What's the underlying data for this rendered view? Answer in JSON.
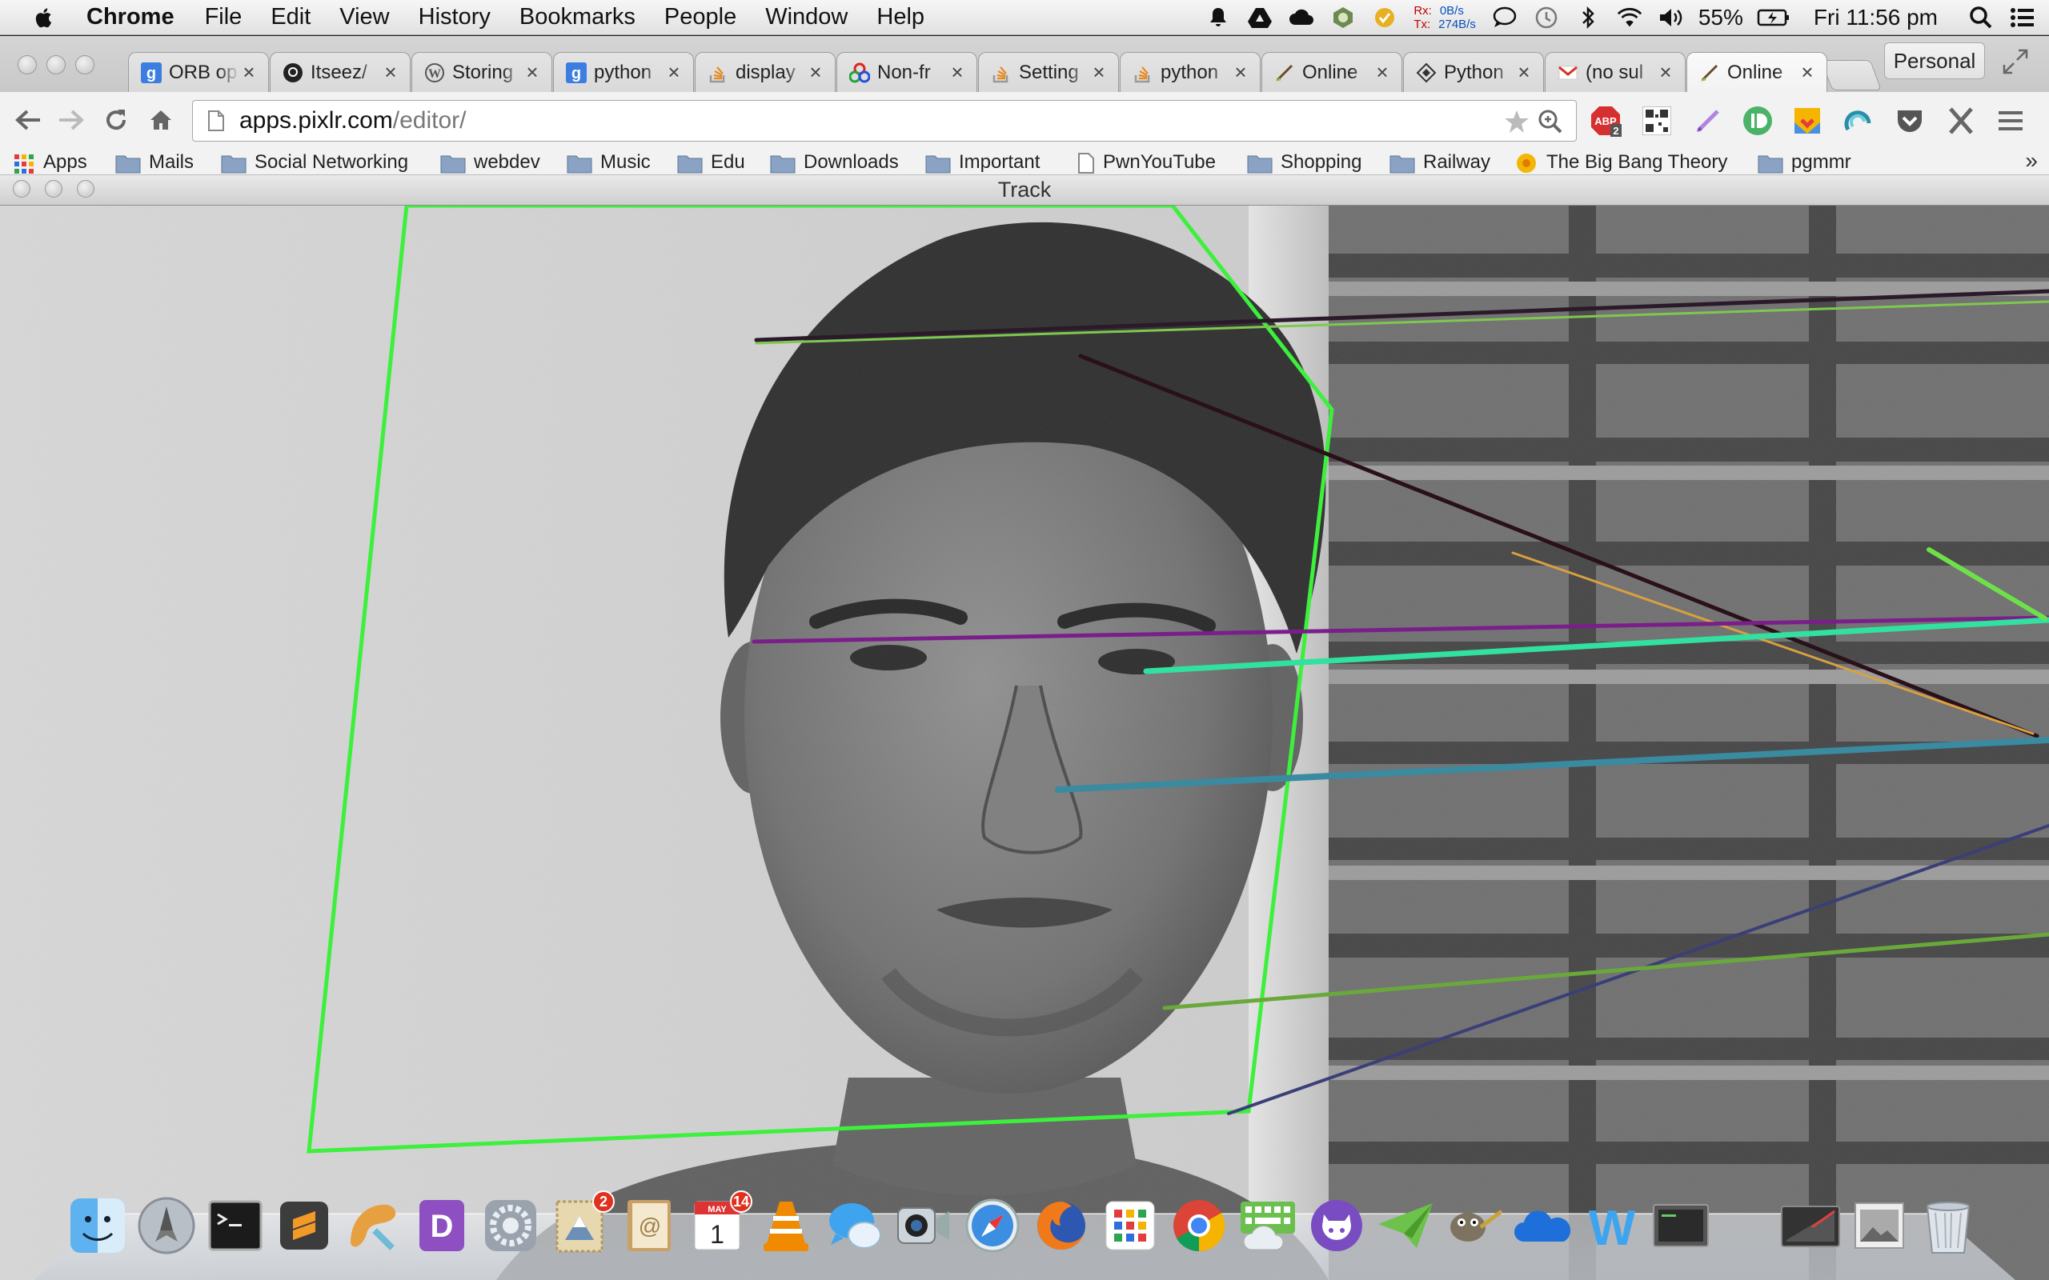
{
  "menubar": {
    "app_name": "Chrome",
    "items": [
      "File",
      "Edit",
      "View",
      "History",
      "Bookmarks",
      "People",
      "Window",
      "Help"
    ],
    "status": {
      "net_rx_label": "Rx:",
      "net_rx_value": "0B/s",
      "net_tx_label": "Tx:",
      "net_tx_value": "274B/s",
      "battery": "55%",
      "clock": "Fri 11:56 pm"
    }
  },
  "tabs": [
    {
      "title": "ORB op",
      "icon": "google-icon"
    },
    {
      "title": "Itseez/",
      "icon": "github-icon"
    },
    {
      "title": "Storing",
      "icon": "wordpress-icon"
    },
    {
      "title": "python",
      "icon": "google-icon"
    },
    {
      "title": "display",
      "icon": "stackoverflow-icon"
    },
    {
      "title": "Non-fr",
      "icon": "colorful-logo-icon"
    },
    {
      "title": "Setting",
      "icon": "stackoverflow-icon"
    },
    {
      "title": "python",
      "icon": "stackoverflow-icon"
    },
    {
      "title": "Online",
      "icon": "pixlr-brush-icon"
    },
    {
      "title": "Python",
      "icon": "python-diamond-icon"
    },
    {
      "title": "(no sul",
      "icon": "gmail-icon"
    },
    {
      "title": "Online",
      "icon": "pixlr-brush-icon",
      "active": true
    }
  ],
  "profile_label": "Personal",
  "omnibox": {
    "host": "apps.pixlr.com",
    "path": "/editor/"
  },
  "extensions": {
    "abp_label": "ABP",
    "abp_badge": "2"
  },
  "bookmarks": [
    {
      "label": "Apps",
      "icon": "apps-grid-icon"
    },
    {
      "label": "Mails",
      "icon": "folder-icon"
    },
    {
      "label": "Social Networking",
      "icon": "folder-icon"
    },
    {
      "label": "webdev",
      "icon": "folder-icon"
    },
    {
      "label": "Music",
      "icon": "folder-icon"
    },
    {
      "label": "Edu",
      "icon": "folder-icon"
    },
    {
      "label": "Downloads",
      "icon": "folder-icon"
    },
    {
      "label": "Important",
      "icon": "folder-icon"
    },
    {
      "label": "PwnYouTube",
      "icon": "page-icon"
    },
    {
      "label": "Shopping",
      "icon": "folder-icon"
    },
    {
      "label": "Railway",
      "icon": "folder-icon"
    },
    {
      "label": "The Big Bang Theory",
      "icon": "bbt-icon"
    },
    {
      "label": "pgmmr",
      "icon": "folder-icon"
    }
  ],
  "bookmarks_more": "»",
  "track_window": {
    "title": "Track",
    "colors": {
      "box": "#3cf03c",
      "accent_teal": "#32e0a0"
    }
  },
  "dock": {
    "items": [
      "finder-icon",
      "launchpad-icon",
      "terminal-icon",
      "sublime-icon",
      "pixelmator-icon",
      "dash-icon",
      "system-preferences-icon",
      "mail-icon",
      "address-book-icon",
      "calendar-icon",
      "vlc-icon",
      "messages-icon",
      "facetime-icon",
      "safari-icon",
      "firefox-icon",
      "app-grid-icon",
      "chrome-icon",
      "keyboard-cloud-icon",
      "github-octocat-icon",
      "paper-plane-icon",
      "gimp-icon",
      "onedrive-icon",
      "word-icon",
      "console-icon",
      "screen-icon",
      "preview-icon",
      "trash-icon"
    ],
    "mail_badge": "2",
    "calendar_badge": "14",
    "calendar_month": "MAY",
    "calendar_day": "1"
  }
}
